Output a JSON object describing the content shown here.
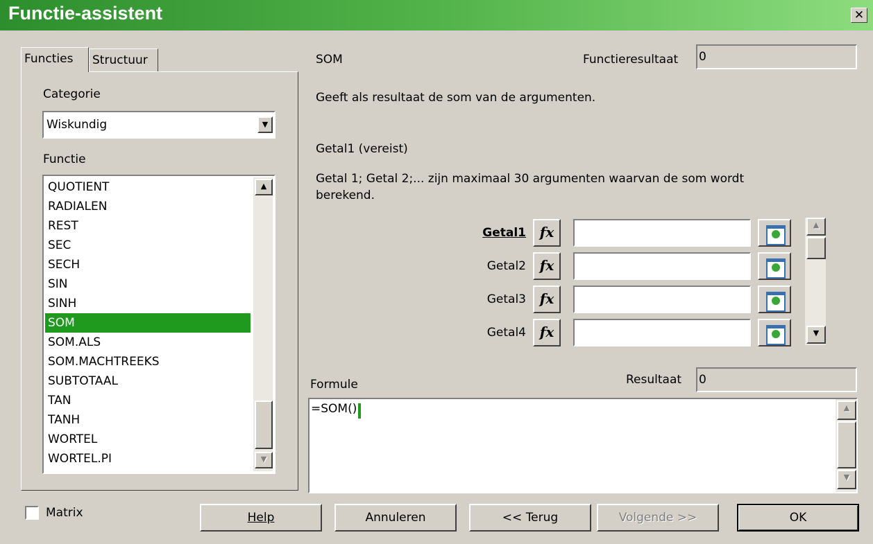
{
  "window": {
    "title": "Functie-assistent",
    "close_glyph": "✕"
  },
  "tabs": [
    {
      "label": "Functies"
    },
    {
      "label": "Structuur"
    }
  ],
  "left": {
    "category_label": "Categorie",
    "category_value": "Wiskundig",
    "function_label": "Functie",
    "functions": [
      "QUOTIENT",
      "RADIALEN",
      "REST",
      "SEC",
      "SECH",
      "SIN",
      "SINH",
      "SOM",
      "SOM.ALS",
      "SOM.MACHTREEKS",
      "SUBTOTAAL",
      "TAN",
      "TANH",
      "WORTEL",
      "WORTEL.PI"
    ],
    "selected_function": "SOM"
  },
  "right": {
    "function_name": "SOM",
    "result_label": "Functieresultaat",
    "result_value": "0",
    "description": "Geeft als resultaat de som van de argumenten.",
    "arg_heading": "Getal1 (vereist)",
    "arg_description_line1": "Getal 1; Getal 2;... zijn maximaal 30 argumenten waarvan de som wordt",
    "arg_description_line2": "berekend.",
    "args": [
      {
        "label": "Getal1",
        "value": ""
      },
      {
        "label": "Getal2",
        "value": ""
      },
      {
        "label": "Getal3",
        "value": ""
      },
      {
        "label": "Getal4",
        "value": ""
      }
    ],
    "fx_glyph": "fx",
    "formula_label": "Formule",
    "formula_result_label": "Resultaat",
    "formula_result_value": "0",
    "formula_text": "=SOM()"
  },
  "footer": {
    "matrix_label": "Matrix",
    "matrix_checked": false,
    "buttons": {
      "help": "Help",
      "cancel": "Annuleren",
      "back": "<< Terug",
      "next": "Volgende >>",
      "ok": "OK"
    }
  },
  "colors": {
    "titlebar_start": "#2d8e2d",
    "titlebar_end": "#8ddc7e",
    "selection": "#1f9a1f",
    "dialog_bg": "#d4d0c8"
  }
}
